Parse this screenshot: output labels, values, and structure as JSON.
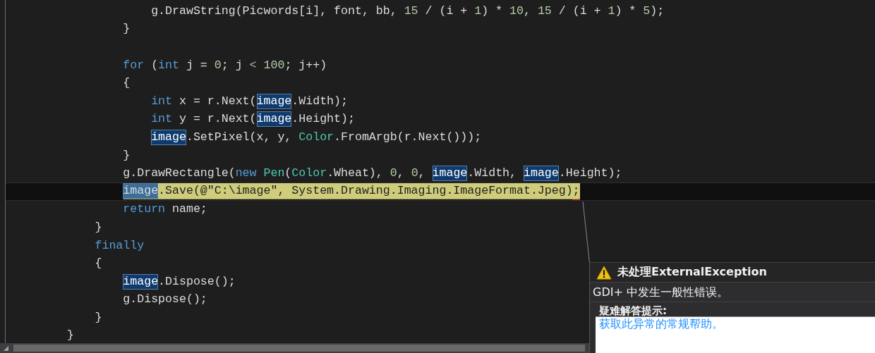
{
  "editor": {
    "lines": [
      {
        "children": [
          {
            "children": [
              {
                "children": [
                  {
                    "current": false,
                    "statement": false,
                    "error": false,
                    "tokens": [
                      {
                        "text": "g.DrawString(Picwords[i], font, bb, ",
                        "kind": "plain"
                      },
                      {
                        "text": "15",
                        "kind": "number"
                      },
                      {
                        "text": " / (i + ",
                        "kind": "plain"
                      },
                      {
                        "text": "1",
                        "kind": "number"
                      },
                      {
                        "text": ") * ",
                        "kind": "plain"
                      },
                      {
                        "text": "10",
                        "kind": "number"
                      },
                      {
                        "text": ", ",
                        "kind": "plain"
                      },
                      {
                        "text": "15",
                        "kind": "number"
                      },
                      {
                        "text": " / (i + ",
                        "kind": "plain"
                      },
                      {
                        "text": "1",
                        "kind": "number"
                      },
                      {
                        "text": ") * ",
                        "kind": "plain"
                      },
                      {
                        "text": "5",
                        "kind": "number"
                      },
                      {
                        "text": ");",
                        "kind": "plain"
                      }
                    ]
                  }
                ]
              },
              {
                "current": false,
                "statement": false,
                "error": false,
                "tokens": [
                  {
                    "text": "}",
                    "kind": "plain"
                  }
                ]
              },
              {
                "current": false,
                "statement": false,
                "error": false
              },
              {
                "current": false,
                "statement": false,
                "error": false,
                "tokens": [
                  {
                    "text": "for",
                    "kind": "keyword"
                  },
                  {
                    "text": " (",
                    "kind": "plain"
                  },
                  {
                    "text": "int",
                    "kind": "keyword"
                  },
                  {
                    "text": " j = ",
                    "kind": "plain"
                  },
                  {
                    "text": "0",
                    "kind": "number"
                  },
                  {
                    "text": "; j ",
                    "kind": "plain"
                  },
                  {
                    "text": "<",
                    "kind": "operator"
                  },
                  {
                    "text": " 100",
                    "kind": "number"
                  },
                  {
                    "text": "; j++)",
                    "kind": "plain"
                  }
                ]
              },
              {
                "current": false,
                "statement": false,
                "error": false,
                "tokens": [
                  {
                    "text": "{",
                    "kind": "plain"
                  }
                ],
                "children": [
                  {
                    "current": false,
                    "statement": false,
                    "error": false,
                    "tokens": [
                      {
                        "text": "int",
                        "kind": "keyword"
                      },
                      {
                        "text": " x = r.Next(",
                        "kind": "plain"
                      },
                      {
                        "text": "image",
                        "kind": "reference"
                      },
                      {
                        "text": ".Width);",
                        "kind": "plain"
                      }
                    ]
                  },
                  {
                    "current": false,
                    "statement": false,
                    "error": false,
                    "tokens": [
                      {
                        "text": "int",
                        "kind": "keyword"
                      },
                      {
                        "text": " y = r.Next(",
                        "kind": "plain"
                      },
                      {
                        "text": "image",
                        "kind": "reference"
                      },
                      {
                        "text": ".Height);",
                        "kind": "plain"
                      }
                    ]
                  },
                  {
                    "current": false,
                    "statement": false,
                    "error": false,
                    "tokens": [
                      {
                        "text": "image",
                        "kind": "reference"
                      },
                      {
                        "text": ".SetPixel(x, y, ",
                        "kind": "plain"
                      },
                      {
                        "text": "Color",
                        "kind": "type"
                      },
                      {
                        "text": ".FromArgb(r.Next()));",
                        "kind": "plain"
                      }
                    ]
                  }
                ]
              },
              {
                "current": false,
                "statement": false,
                "error": false,
                "tokens": [
                  {
                    "text": "}",
                    "kind": "plain"
                  }
                ]
              },
              {
                "current": false,
                "statement": false,
                "error": false,
                "tokens": [
                  {
                    "text": "g.DrawRectangle(",
                    "kind": "plain"
                  },
                  {
                    "text": "new",
                    "kind": "keyword"
                  },
                  {
                    "text": " Pen",
                    "kind": "type"
                  },
                  {
                    "text": "(",
                    "kind": "plain"
                  },
                  {
                    "text": "Color",
                    "kind": "type"
                  },
                  {
                    "text": ".Wheat), ",
                    "kind": "plain"
                  },
                  {
                    "text": "0",
                    "kind": "number"
                  },
                  {
                    "text": ", ",
                    "kind": "plain"
                  },
                  {
                    "text": "0",
                    "kind": "number"
                  },
                  {
                    "text": ", ",
                    "kind": "plain"
                  },
                  {
                    "text": "image",
                    "kind": "reference"
                  },
                  {
                    "text": ".Width, ",
                    "kind": "plain"
                  },
                  {
                    "text": "image",
                    "kind": "reference"
                  },
                  {
                    "text": ".Height);",
                    "kind": "plain"
                  }
                ]
              },
              {
                "current": true,
                "statement": true,
                "error": true,
                "tokens": [
                  {
                    "text": "image",
                    "kind": "reference"
                  },
                  {
                    "text": ".Save(@\"C:\\image\", System.Drawing.Imaging.ImageFormat.Jpeg);",
                    "kind": "plain"
                  }
                ]
              },
              {
                "current": false,
                "statement": false,
                "error": false,
                "tokens": [
                  {
                    "text": "return",
                    "kind": "keyword"
                  },
                  {
                    "text": " name;",
                    "kind": "plain"
                  }
                ]
              }
            ]
          },
          {
            "current": false,
            "statement": false,
            "error": false,
            "tokens": [
              {
                "text": "}",
                "kind": "plain"
              }
            ]
          },
          {
            "current": false,
            "statement": false,
            "error": false,
            "tokens": [
              {
                "text": "finally",
                "kind": "keyword"
              }
            ]
          },
          {
            "current": false,
            "statement": false,
            "error": false,
            "tokens": [
              {
                "text": "{",
                "kind": "plain"
              }
            ],
            "children": [
              {
                "current": false,
                "statement": false,
                "error": false,
                "tokens": [
                  {
                    "text": "image",
                    "kind": "reference"
                  },
                  {
                    "text": ".Dispose();",
                    "kind": "plain"
                  }
                ]
              },
              {
                "current": false,
                "statement": false,
                "error": false,
                "tokens": [
                  {
                    "text": "g.Dispose();",
                    "kind": "plain"
                  }
                ]
              }
            ]
          },
          {
            "current": false,
            "statement": false,
            "error": false,
            "tokens": [
              {
                "text": "}",
                "kind": "plain"
              }
            ]
          }
        ]
      },
      {
        "current": false,
        "statement": false,
        "error": false,
        "tokens": [
          {
            "text": "}",
            "kind": "plain"
          }
        ]
      }
    ]
  },
  "exception_popup": {
    "title": "未处理ExternalException",
    "message": "GDI+ 中发生一般性错误。",
    "troubleshooting_heading": "疑难解答提示:",
    "links": [
      "获取此异常的常规帮助。"
    ]
  }
}
